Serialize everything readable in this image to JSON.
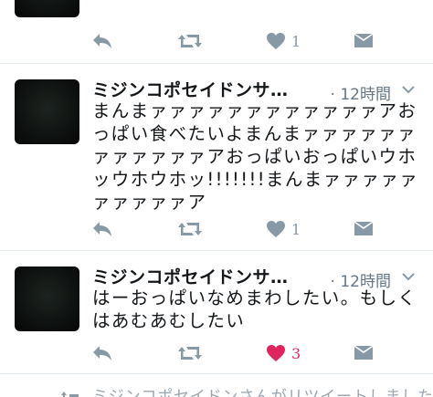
{
  "tweets": [
    {
      "like_count": "1",
      "liked": false
    },
    {
      "author": "ミジンコポセイドンサ…",
      "time": "· 12時間",
      "text": "まんまァァァァァァァァァァァァアおっぱい食べたいよまんまァァァァァァァァァァァァアおっぱいおっぱいウホッウホウホッ!!!!!!!まんまァァァァァァァァァァア",
      "like_count": "1",
      "liked": false
    },
    {
      "author": "ミジンコポセイドンサ…",
      "time": "· 12時間",
      "text": "はーおっぱいなめまわしたい。もしくはあむあむしたい",
      "like_count": "3",
      "liked": true
    }
  ],
  "partial_next": {
    "text": "ミジンコポセイドンさんがリツイートしました"
  },
  "colors": {
    "icon": "#8899a6",
    "like_active": "#e0245e",
    "timestamp": "#657786",
    "divider": "#e1e8ed"
  },
  "icons": [
    "reply-icon",
    "retweet-icon",
    "heart-icon",
    "dm-icon",
    "caret-down-icon"
  ]
}
